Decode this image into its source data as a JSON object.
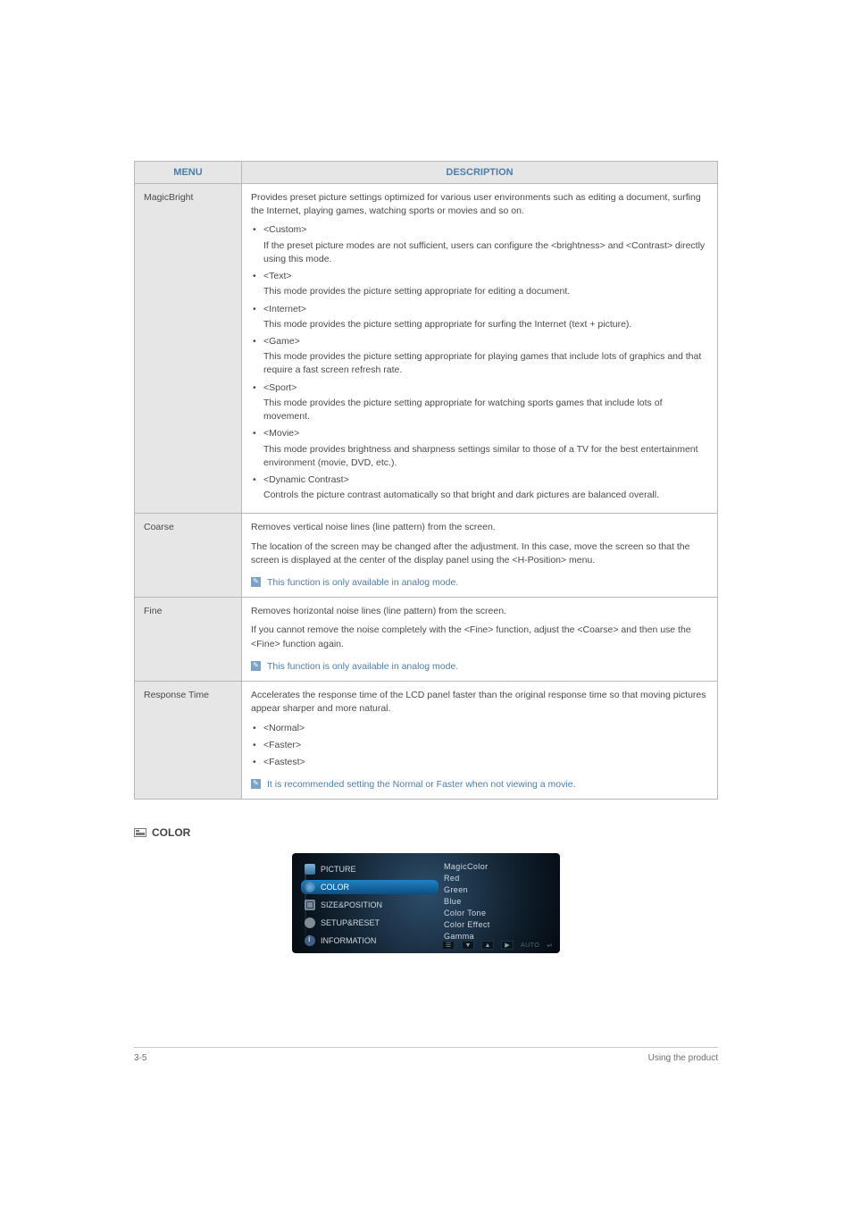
{
  "table": {
    "headers": {
      "menu": "MENU",
      "description": "DESCRIPTION"
    },
    "rows": {
      "magicbright": {
        "name": "MagicBright",
        "intro": "Provides preset picture settings optimized for various user environments such as editing a document, surfing the Internet, playing games, watching sports or movies and so on.",
        "items": [
          {
            "label": "<Custom>",
            "desc": "If the preset picture modes are not sufficient, users can configure the <brightness> and <Contrast> directly using this mode."
          },
          {
            "label": "<Text>",
            "desc": "This mode provides the picture setting appropriate for editing a document."
          },
          {
            "label": "<Internet>",
            "desc": "This mode provides the picture setting appropriate for surfing the Internet (text + picture)."
          },
          {
            "label": "<Game>",
            "desc": "This mode provides the picture setting appropriate for playing games that include lots of graphics and that require a fast screen refresh rate."
          },
          {
            "label": "<Sport>",
            "desc": "This mode provides the picture setting appropriate for watching sports games that include lots of movement."
          },
          {
            "label": "<Movie>",
            "desc": "This mode provides brightness and sharpness settings similar to those of a TV for the best entertainment environment (movie, DVD, etc.)."
          },
          {
            "label": "<Dynamic Contrast>",
            "desc": "Controls the picture contrast automatically so that bright and dark pictures are balanced overall."
          }
        ]
      },
      "coarse": {
        "name": "Coarse",
        "p1": "Removes vertical noise lines (line pattern) from the screen.",
        "p2": "The location of the screen may be changed after the adjustment. In this case, move the screen so that the screen is displayed at the center of the display panel using the <H-Position> menu.",
        "note": "This function is only available in analog mode."
      },
      "fine": {
        "name": "Fine",
        "p1": "Removes horizontal noise lines (line pattern) from the screen.",
        "p2": "If you cannot remove the noise completely with the <Fine> function, adjust the <Coarse> and then use the <Fine> function again.",
        "note": "This function is only available in analog mode."
      },
      "response": {
        "name": "Response Time",
        "p1": "Accelerates the response time of the LCD panel faster than the original response time so that moving pictures appear sharper and more natural.",
        "items": [
          "<Normal>",
          "<Faster>",
          "<Fastest>"
        ],
        "note": "It is recommended setting the Normal or Faster when not viewing a movie."
      }
    }
  },
  "section_color": "COLOR",
  "osd": {
    "left": {
      "picture": "PICTURE",
      "color": "COLOR",
      "size": "SIZE&POSITION",
      "setup": "SETUP&RESET",
      "info": "INFORMATION"
    },
    "right": [
      "MagicColor",
      "Red",
      "Green",
      "Blue",
      "Color Tone",
      "Color Effect",
      "Gamma"
    ],
    "auto": "AUTO"
  },
  "footer": {
    "left": "3-5",
    "right": "Using the product"
  }
}
